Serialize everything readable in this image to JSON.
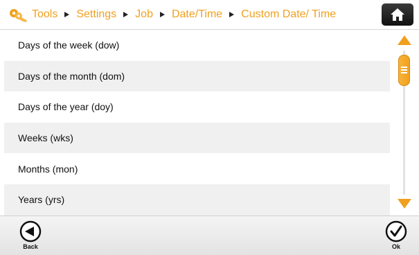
{
  "breadcrumb": {
    "items": [
      "Tools",
      "Settings",
      "Job",
      "Date/Time",
      "Custom Date/ Time"
    ]
  },
  "icons": {
    "app": "keys-icon",
    "home": "home-icon",
    "back": "back-arrow-icon",
    "ok": "checkmark-icon"
  },
  "list": {
    "items": [
      "Days of the week (dow)",
      "Days of the month (dom)",
      "Days of the year (doy)",
      "Weeks (wks)",
      "Months (mon)",
      "Years (yrs)"
    ]
  },
  "footer": {
    "back_label": "Back",
    "ok_label": "Ok"
  },
  "colors": {
    "accent": "#f0a01e",
    "row_alt": "#f0f0f0",
    "home_button": "#1a1a1a"
  }
}
